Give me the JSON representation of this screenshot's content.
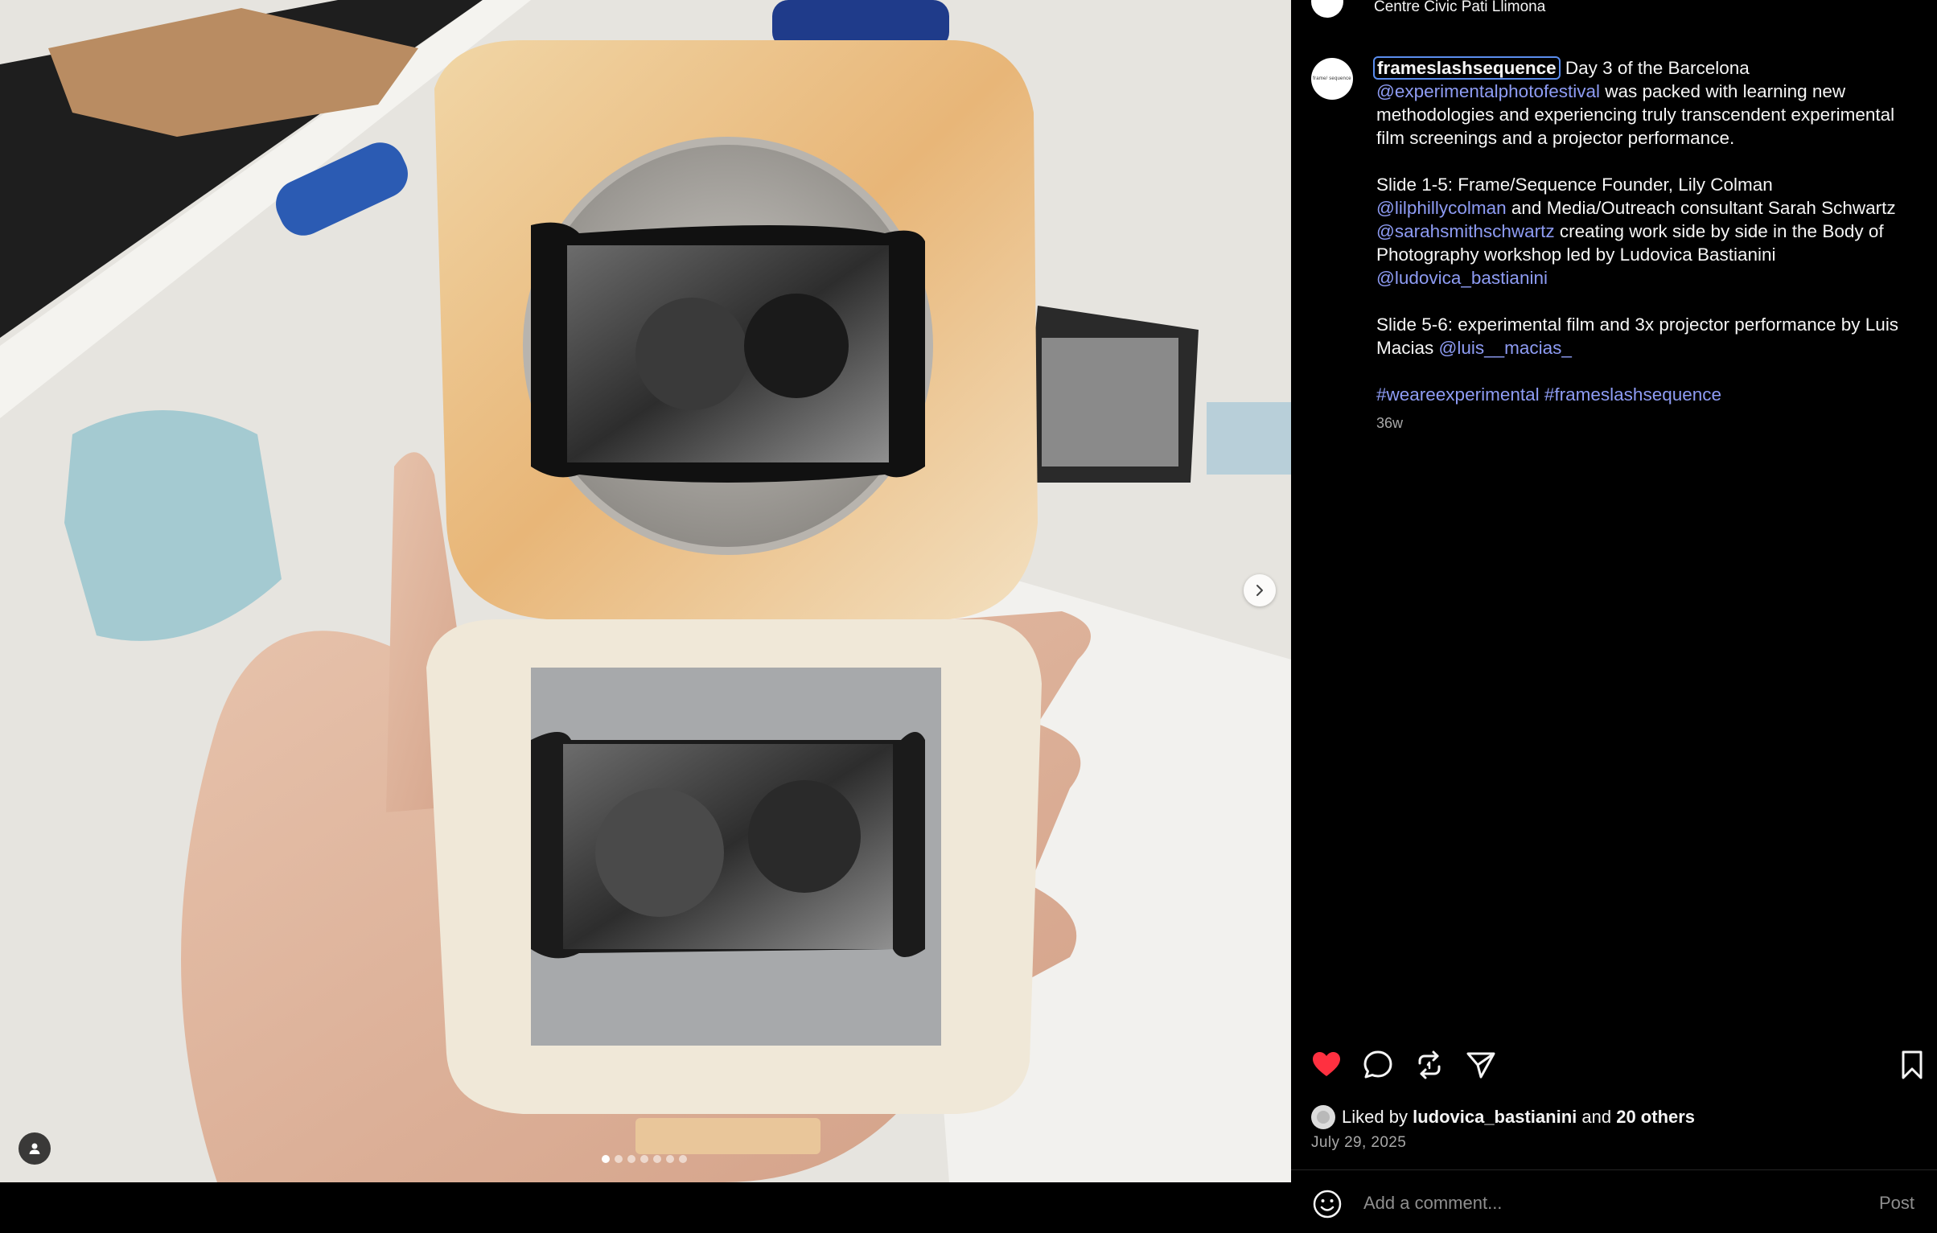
{
  "post": {
    "location": "Centre Civic Pati Llimona",
    "caption_avatar_text": "frame/ sequence",
    "username": "frameslashsequence",
    "caption": [
      [
        {
          "t": "text",
          "v": "Day 3 of the Barcelona "
        },
        {
          "t": "mention",
          "v": "@experimentalphotofestival"
        },
        {
          "t": "text",
          "v": " was packed with learning new methodologies and experiencing truly transcendent experimental film screenings and a projector performance."
        }
      ],
      [
        {
          "t": "text",
          "v": "Slide 1-5: Frame/Sequence Founder, Lily Colman "
        },
        {
          "t": "mention",
          "v": "@lilphillycolman"
        },
        {
          "t": "text",
          "v": " and Media/Outreach consultant Sarah Schwartz "
        },
        {
          "t": "mention",
          "v": "@sarahsmithschwartz"
        },
        {
          "t": "text",
          "v": " creating work side by side in the Body of Photography workshop led by Ludovica Bastianini "
        },
        {
          "t": "mention",
          "v": "@ludovica_bastianini"
        }
      ],
      [
        {
          "t": "text",
          "v": "Slide 5-6: experimental film and 3x projector performance by Luis Macias "
        },
        {
          "t": "mention",
          "v": "@luis__macias_"
        }
      ],
      [
        {
          "t": "tag",
          "v": "#weareexperimental"
        },
        {
          "t": "text",
          "v": " "
        },
        {
          "t": "tag",
          "v": "#frameslashsequence"
        }
      ]
    ],
    "time_ago": "36w",
    "liked_by_prefix": "Liked by",
    "liked_by_user": "ludovica_bastianini",
    "liked_by_and": "and",
    "liked_by_others": "20 others",
    "date": "July 29, 2025"
  },
  "media": {
    "carousel_count": 7,
    "carousel_active": 1
  },
  "actions": {
    "icons": [
      "heart-icon",
      "comment-icon",
      "repost-icon",
      "share-icon",
      "bookmark-icon"
    ],
    "liked": true
  },
  "comment": {
    "placeholder": "Add a comment...",
    "post_label": "Post"
  },
  "colors": {
    "like_red": "#ff3040",
    "mention_blue": "#8e9cf4",
    "focus_outline": "#5a8dee",
    "panel_bg": "#000000"
  }
}
